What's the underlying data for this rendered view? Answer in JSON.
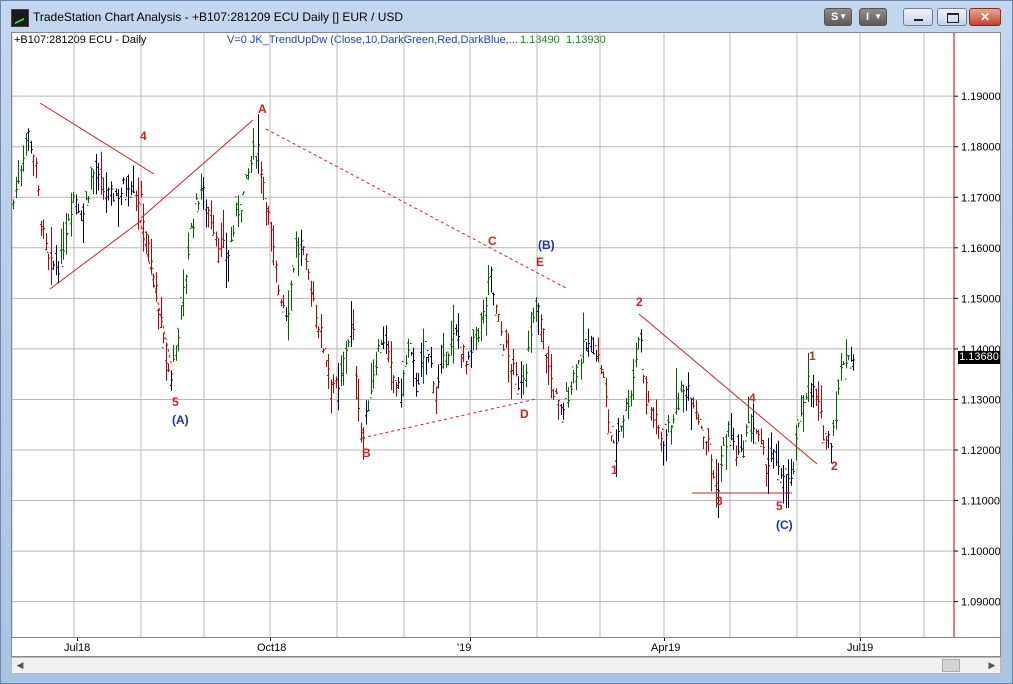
{
  "window": {
    "title": "TradeStation Chart Analysis - +B107:281209 ECU Daily [] EUR / USD",
    "s_button": "S",
    "i_button": "I",
    "close_symbol": "✕"
  },
  "header": {
    "symbol": "+B107:281209 ECU - Daily",
    "indicator": "V=0  JK_TrendUpDw  (Close,10,DarkGreen,Red,DarkBlue,...",
    "value1": "1.13490",
    "value2": "1.13930"
  },
  "last_price": "1.13680",
  "chart_data": {
    "type": "bar",
    "ylim": [
      1.083,
      1.2025
    ],
    "yticks": [
      "1.19000",
      "1.18000",
      "1.17000",
      "1.16000",
      "1.15000",
      "1.14000",
      "1.13000",
      "1.12000",
      "1.11000",
      "1.10000",
      "1.09000"
    ],
    "x_labels": [
      "Jul18",
      "Oct18",
      "'19",
      "Apr19",
      "Jul19"
    ],
    "colors": {
      "up": "#006400",
      "down": "#c00000",
      "neutral": "#000040",
      "red": "#d62020",
      "blue": "#1f2fb0"
    },
    "wave_labels": [
      {
        "text": "4",
        "color": "red"
      },
      {
        "text": "5",
        "color": "red"
      },
      {
        "text": "(A)",
        "color": "blue"
      },
      {
        "text": "A",
        "color": "red"
      },
      {
        "text": "B",
        "color": "red"
      },
      {
        "text": "C",
        "color": "red"
      },
      {
        "text": "(B)",
        "color": "blue"
      },
      {
        "text": "E",
        "color": "red"
      },
      {
        "text": "D",
        "color": "red"
      },
      {
        "text": "1",
        "color": "red"
      },
      {
        "text": "2",
        "color": "red"
      },
      {
        "text": "3",
        "color": "red"
      },
      {
        "text": "4",
        "color": "red"
      },
      {
        "text": "5",
        "color": "red"
      },
      {
        "text": "(C)",
        "color": "blue"
      },
      {
        "text": "1",
        "color": "red"
      },
      {
        "text": "2",
        "color": "red"
      }
    ]
  }
}
